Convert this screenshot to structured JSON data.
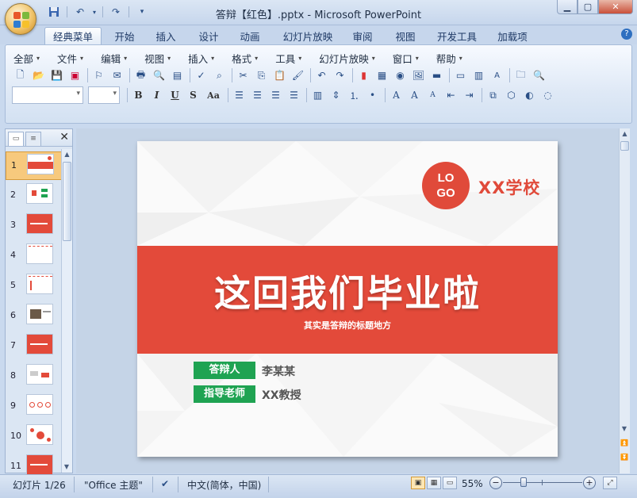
{
  "window": {
    "title": "答辩【红色】.pptx - Microsoft PowerPoint"
  },
  "quick_access": {
    "save": "save-icon",
    "undo": "undo-icon",
    "redo": "redo-icon"
  },
  "ribbon_tabs": [
    "经典菜单",
    "开始",
    "插入",
    "设计",
    "动画",
    "幻灯片放映",
    "审阅",
    "视图",
    "开发工具",
    "加载项"
  ],
  "menus": [
    "全部",
    "文件",
    "编辑",
    "视图",
    "插入",
    "格式",
    "工具",
    "幻灯片放映",
    "窗口",
    "帮助"
  ],
  "format_buttons": {
    "bold": "B",
    "italic": "I",
    "underline": "U",
    "shadow": "S",
    "case": "Aa"
  },
  "slide_count": 11,
  "slide_numbers": [
    "1",
    "2",
    "3",
    "4",
    "5",
    "6",
    "7",
    "8",
    "9",
    "10",
    "11"
  ],
  "slide": {
    "logo_line1": "LO",
    "logo_line2": "GO",
    "school": "XX学校",
    "title": "这回我们毕业啦",
    "subtitle": "其实是答辩的标题地方",
    "respondent_tag": "答辩人",
    "respondent_name": "李某某",
    "advisor_tag": "指导老师",
    "advisor_name": "XX教授"
  },
  "status": {
    "slide_info": "幻灯片 1/26",
    "theme": "\"Office 主题\"",
    "language": "中文(简体，中国)",
    "zoom": "55%"
  },
  "colors": {
    "accent_red": "#e34a3a",
    "tag_green": "#1fa352",
    "ribbon": "#dfe9f6"
  }
}
